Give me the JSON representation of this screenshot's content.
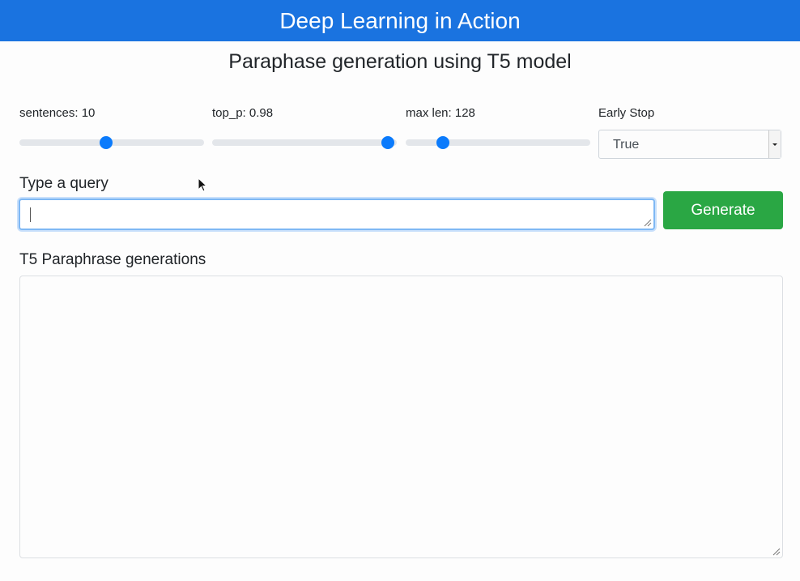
{
  "header": {
    "title": "Deep Learning in Action"
  },
  "page": {
    "subtitle": "Paraphase generation using T5 model"
  },
  "controls": {
    "sentences": {
      "label": "sentences: 10",
      "value_fraction": 0.47
    },
    "top_p": {
      "label": "top_p: 0.98",
      "value_fraction": 0.95
    },
    "max_len": {
      "label": "max len: 128",
      "value_fraction": 0.2
    },
    "early_stop": {
      "label": "Early Stop",
      "selected": "True"
    }
  },
  "query": {
    "label": "Type a query",
    "value": ""
  },
  "generate": {
    "label": "Generate"
  },
  "output": {
    "label": "T5 Paraphrase generations",
    "value": ""
  },
  "colors": {
    "header_bg": "#1a73e0",
    "slider_thumb": "#0b7bfc",
    "generate_button": "#2aa744"
  }
}
